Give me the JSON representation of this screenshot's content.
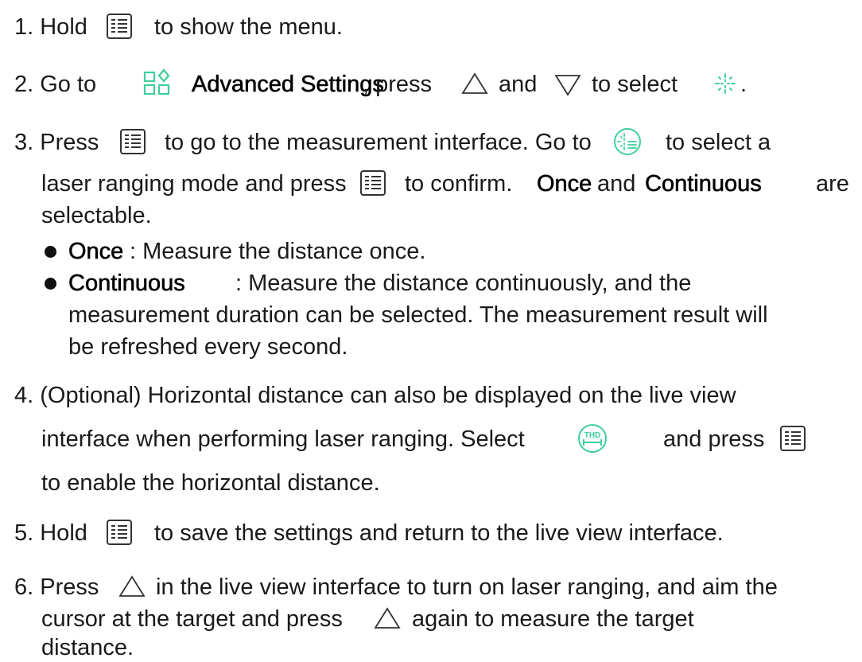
{
  "steps": {
    "s1": {
      "a": "1. Hold",
      "b": "to show the menu."
    },
    "s2": {
      "a": "2. Go to",
      "bold": "Advanced Settings",
      "b": ", press",
      "c": "and",
      "d": "to select",
      "e": "."
    },
    "s3": {
      "a": "3. Press",
      "b": "to go to the measurement interface. Go to",
      "c": "to select a",
      "d": "laser ranging mode and press",
      "e": "to confirm.",
      "once": "Once",
      "f": "and",
      "cont": "Continuous",
      "g": "are",
      "h": "selectable."
    },
    "bullets": [
      {
        "term": "Once",
        "text": ": Measure the distance once."
      },
      {
        "term": "Continuous",
        "text": ": Measure the distance continuously, and the",
        "text2": "measurement duration can be selected. The measurement result will",
        "text3": "be refreshed every second."
      }
    ],
    "s4": {
      "a": "4. (Optional) Horizontal distance can also be displayed on the live view",
      "b": "interface when performing laser ranging. Select",
      "c": "and press",
      "d": "to enable the horizontal distance."
    },
    "s5": {
      "a": "5. Hold",
      "b": "to save the settings and return to the live view interface."
    },
    "s6": {
      "a": "6. Press",
      "b": "in the live view interface to turn on laser ranging, and aim the",
      "c": "cursor at the target and press",
      "d": "again to measure the target",
      "e": "distance."
    }
  },
  "icons": {
    "menu": "menu-list-icon",
    "advanced": "advanced-settings-icon",
    "up": "up-triangle-icon",
    "down": "down-triangle-icon",
    "laser": "laser-ranging-icon",
    "laser_mode": "laser-mode-circle-icon",
    "thd": "horizontal-distance-icon",
    "thd_label": "THD"
  },
  "colors": {
    "icon_green": "#3fcf9a",
    "text": "#1a1a1a"
  }
}
